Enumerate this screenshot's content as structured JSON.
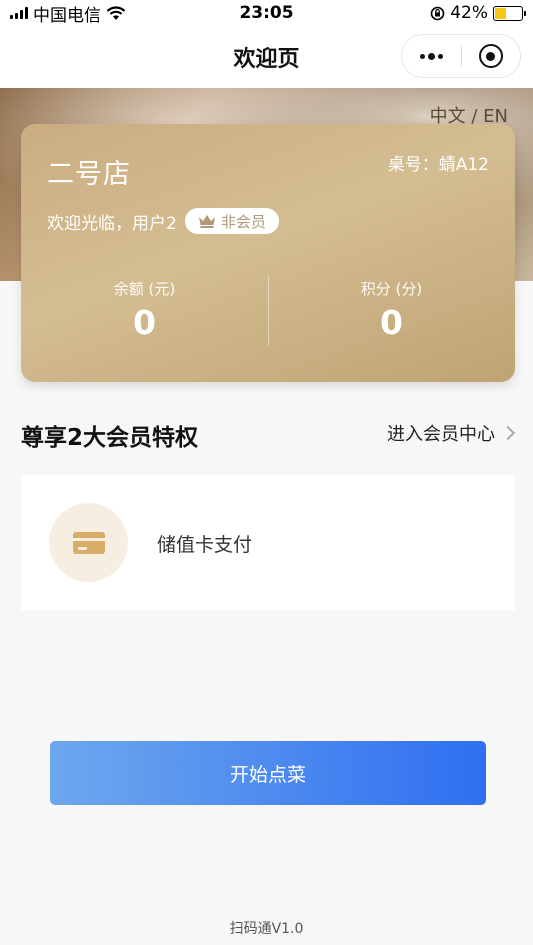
{
  "status_bar": {
    "carrier": "中国电信",
    "time": "23:05",
    "battery_text": "42%",
    "battery_level": 0.42,
    "icons": [
      "signal-icon",
      "wifi-icon",
      "orientation-lock-icon",
      "battery-charging-icon"
    ]
  },
  "nav": {
    "title": "欢迎页",
    "icons": [
      "more-dots-icon",
      "close-target-icon"
    ]
  },
  "banner": {
    "language_switch": "中文 / EN"
  },
  "card": {
    "store_name": "二号店",
    "table_no": "桌号：蜻A12",
    "welcome": "欢迎光临，用户2",
    "member_status": "非会员",
    "balance_label": "余额 (元)",
    "balance_value": "0",
    "points_label": "积分 (分)",
    "points_value": "0"
  },
  "privileges": {
    "heading": "尊享2大会员特权",
    "member_center_link": "进入会员中心",
    "items": [
      {
        "label": "储值卡支付",
        "icon": "stored-value-card-icon"
      }
    ]
  },
  "start_button": "开始点菜",
  "footer": {
    "version": "扫码通V1.0"
  },
  "colors": {
    "card_gold": "#c9ad80",
    "button_start": "#6ea7ee",
    "button_end": "#2f6ff0",
    "icon_gold": "#d8ad68"
  }
}
